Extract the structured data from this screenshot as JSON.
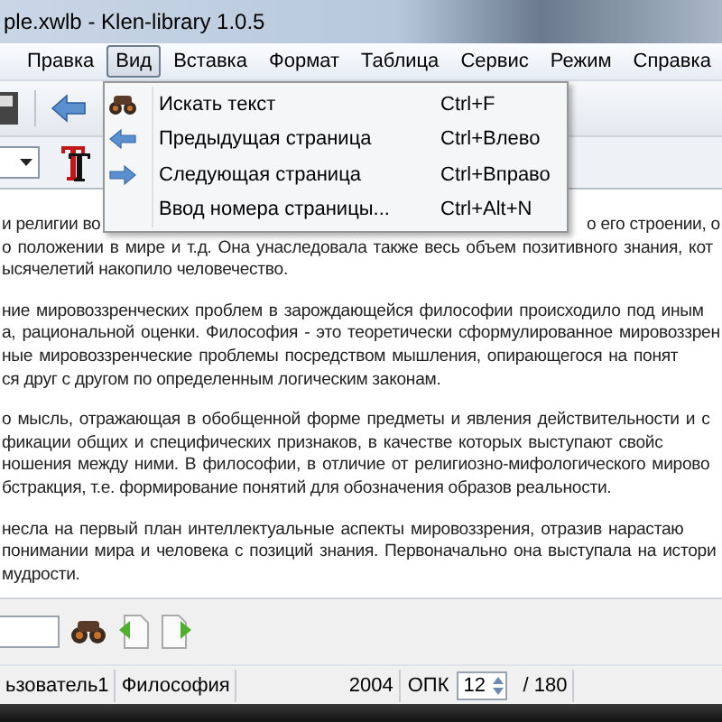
{
  "window": {
    "title": "ple.xwlb - Klen-library 1.0.5"
  },
  "menu": [
    {
      "label": "Правка",
      "selected": false
    },
    {
      "label": "Вид",
      "selected": true
    },
    {
      "label": "Вставка",
      "selected": false
    },
    {
      "label": "Формат",
      "selected": false
    },
    {
      "label": "Таблица",
      "selected": false
    },
    {
      "label": "Сервис",
      "selected": false
    },
    {
      "label": "Режим",
      "selected": false
    },
    {
      "label": "Справка",
      "selected": false
    }
  ],
  "dropdown": [
    {
      "kind": "search",
      "label": "Искать текст",
      "shortcut": "Ctrl+F"
    },
    {
      "kind": "prev",
      "label": "Предыдущая страница",
      "shortcut": "Ctrl+Влево"
    },
    {
      "kind": "next",
      "label": "Следующая страница",
      "shortcut": "Ctrl+Вправо"
    },
    {
      "kind": "plain",
      "label": "Ввод номера страницы...",
      "shortcut": "Ctrl+Alt+N"
    }
  ],
  "document": {
    "first_line": {
      "left": "и религии во",
      "right": "о его строении, о"
    },
    "paragraphs": [
      [
        "о положении в мире и т.д. Она унаследовала также весь объем позитивного знания, кот",
        "ысячелетий накопило человечество."
      ],
      [
        "ние мировоззренческих проблем в зарождающейся философии происходило под иным",
        "а, рациональной оценки. Философия - это теоретически сформулированное мировоззрен",
        "ные мировоззренческие проблемы посредством мышления, опирающегося на понят",
        "ся друг с другом по определенным логическим законам."
      ],
      [
        "о мысль, отражающая в обобщенной форме предметы и явления действительности и с",
        "фикации общих и специфических признаков, в качестве которых выступают свойс",
        "ношения между ними. В философии, в отличие от религиозно-мифологического мирово",
        "бстракция, т.е. формирование понятий для обозначения образов реальности."
      ],
      [
        "несла на первый план интеллектуальные аспекты мировоззрения, отразив нарастаю",
        "понимании мира и человека с позиций знания. Первоначально она выступала на истори",
        "мудрости."
      ]
    ]
  },
  "status_bar": {
    "user": "ьзователь1",
    "category": "Философия",
    "year": "2004",
    "label": "ОПК",
    "page": "12",
    "total": "/ 180"
  }
}
